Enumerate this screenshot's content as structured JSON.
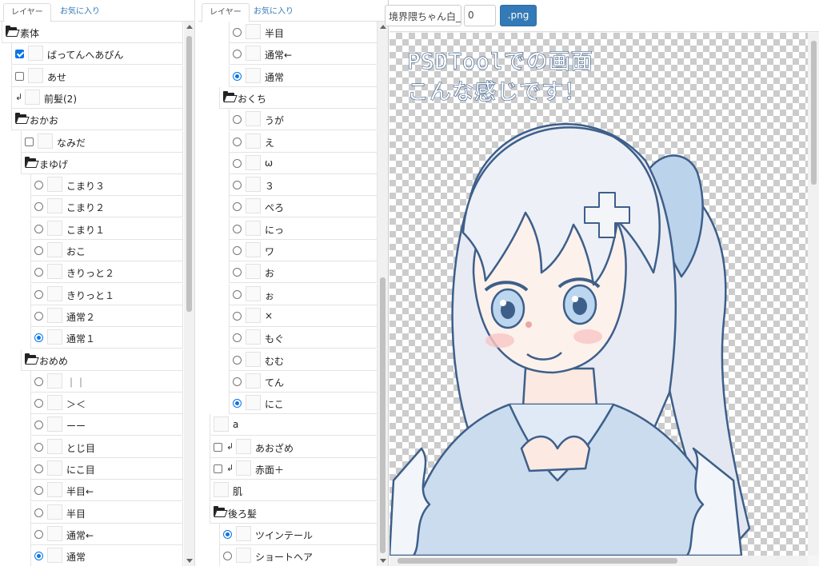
{
  "panel1": {
    "tabs": [
      "レイヤー",
      "お気に入り"
    ],
    "rows": [
      {
        "type": "folder",
        "indent": 0,
        "label": "素体"
      },
      {
        "type": "layer",
        "indent": 1,
        "control": "checkbox",
        "checked": true,
        "label": "ばってんへあぴん"
      },
      {
        "type": "layer",
        "indent": 1,
        "control": "checkbox",
        "checked": false,
        "label": "あせ"
      },
      {
        "type": "layer",
        "indent": 1,
        "control": "return",
        "label": "前髪(2)"
      },
      {
        "type": "folder",
        "indent": 1,
        "label": "おかお"
      },
      {
        "type": "layer",
        "indent": 2,
        "control": "checkbox",
        "checked": false,
        "label": "なみだ"
      },
      {
        "type": "folder",
        "indent": 2,
        "label": "まゆげ"
      },
      {
        "type": "layer",
        "indent": 3,
        "control": "radio",
        "checked": false,
        "label": "こまり３"
      },
      {
        "type": "layer",
        "indent": 3,
        "control": "radio",
        "checked": false,
        "label": "こまり２"
      },
      {
        "type": "layer",
        "indent": 3,
        "control": "radio",
        "checked": false,
        "label": "こまり１"
      },
      {
        "type": "layer",
        "indent": 3,
        "control": "radio",
        "checked": false,
        "label": "おこ"
      },
      {
        "type": "layer",
        "indent": 3,
        "control": "radio",
        "checked": false,
        "label": "きりっと２"
      },
      {
        "type": "layer",
        "indent": 3,
        "control": "radio",
        "checked": false,
        "label": "きりっと１"
      },
      {
        "type": "layer",
        "indent": 3,
        "control": "radio",
        "checked": false,
        "label": "通常２"
      },
      {
        "type": "layer",
        "indent": 3,
        "control": "radio",
        "checked": true,
        "label": "通常１"
      },
      {
        "type": "folder",
        "indent": 2,
        "label": "おめめ"
      },
      {
        "type": "layer",
        "indent": 3,
        "control": "radio",
        "checked": false,
        "label": "｜｜"
      },
      {
        "type": "layer",
        "indent": 3,
        "control": "radio",
        "checked": false,
        "label": "＞＜"
      },
      {
        "type": "layer",
        "indent": 3,
        "control": "radio",
        "checked": false,
        "label": "ーー"
      },
      {
        "type": "layer",
        "indent": 3,
        "control": "radio",
        "checked": false,
        "label": "とじ目"
      },
      {
        "type": "layer",
        "indent": 3,
        "control": "radio",
        "checked": false,
        "label": "にこ目"
      },
      {
        "type": "layer",
        "indent": 3,
        "control": "radio",
        "checked": false,
        "label": "半目←"
      },
      {
        "type": "layer",
        "indent": 3,
        "control": "radio",
        "checked": false,
        "label": "半目"
      },
      {
        "type": "layer",
        "indent": 3,
        "control": "radio",
        "checked": false,
        "label": "通常←"
      },
      {
        "type": "layer",
        "indent": 3,
        "control": "radio",
        "checked": true,
        "label": "通常"
      }
    ]
  },
  "panel2": {
    "tabs": [
      "レイヤー",
      "お気に入り"
    ],
    "rows": [
      {
        "type": "layer",
        "indent": 3,
        "control": "radio",
        "checked": false,
        "label": "半目"
      },
      {
        "type": "layer",
        "indent": 3,
        "control": "radio",
        "checked": false,
        "label": "通常←"
      },
      {
        "type": "layer",
        "indent": 3,
        "control": "radio",
        "checked": true,
        "label": "通常"
      },
      {
        "type": "folder",
        "indent": 2,
        "label": "おくち"
      },
      {
        "type": "layer",
        "indent": 3,
        "control": "radio",
        "checked": false,
        "label": "うが"
      },
      {
        "type": "layer",
        "indent": 3,
        "control": "radio",
        "checked": false,
        "label": "え"
      },
      {
        "type": "layer",
        "indent": 3,
        "control": "radio",
        "checked": false,
        "label": "ω"
      },
      {
        "type": "layer",
        "indent": 3,
        "control": "radio",
        "checked": false,
        "label": "３"
      },
      {
        "type": "layer",
        "indent": 3,
        "control": "radio",
        "checked": false,
        "label": "ぺろ"
      },
      {
        "type": "layer",
        "indent": 3,
        "control": "radio",
        "checked": false,
        "label": "にっ"
      },
      {
        "type": "layer",
        "indent": 3,
        "control": "radio",
        "checked": false,
        "label": "ワ"
      },
      {
        "type": "layer",
        "indent": 3,
        "control": "radio",
        "checked": false,
        "label": "お"
      },
      {
        "type": "layer",
        "indent": 3,
        "control": "radio",
        "checked": false,
        "label": "ぉ"
      },
      {
        "type": "layer",
        "indent": 3,
        "control": "radio",
        "checked": false,
        "label": "×"
      },
      {
        "type": "layer",
        "indent": 3,
        "control": "radio",
        "checked": false,
        "label": "もぐ"
      },
      {
        "type": "layer",
        "indent": 3,
        "control": "radio",
        "checked": false,
        "label": "むむ"
      },
      {
        "type": "layer",
        "indent": 3,
        "control": "radio",
        "checked": false,
        "label": "てん"
      },
      {
        "type": "layer",
        "indent": 3,
        "control": "radio",
        "checked": true,
        "label": "にこ"
      },
      {
        "type": "layer",
        "indent": 1,
        "control": "none",
        "label": "a"
      },
      {
        "type": "layer",
        "indent": 1,
        "control": "checkbox-return",
        "checked": false,
        "label": "あおざめ"
      },
      {
        "type": "layer",
        "indent": 1,
        "control": "checkbox-return",
        "checked": false,
        "label": "赤面＋"
      },
      {
        "type": "layer",
        "indent": 1,
        "control": "none",
        "label": "肌"
      },
      {
        "type": "folder",
        "indent": 1,
        "label": "後ろ髪"
      },
      {
        "type": "layer",
        "indent": 2,
        "control": "radio",
        "checked": true,
        "label": "ツインテール"
      },
      {
        "type": "layer",
        "indent": 2,
        "control": "radio",
        "checked": false,
        "label": "ショートヘア"
      }
    ]
  },
  "toolbar": {
    "filename": "境界隈ちゃん白_",
    "number": "0",
    "export_label": ".png"
  },
  "canvas": {
    "caption_line1": "PSDToolでの画面",
    "caption_line2": "こんな感じです！"
  },
  "colors": {
    "accent": "#337ab7",
    "checked": "#0a75e8",
    "hair": "#e6e9f2",
    "outline": "#3d5f8a",
    "hoodie": "#c9dbee",
    "skin": "#fdf0ea"
  }
}
